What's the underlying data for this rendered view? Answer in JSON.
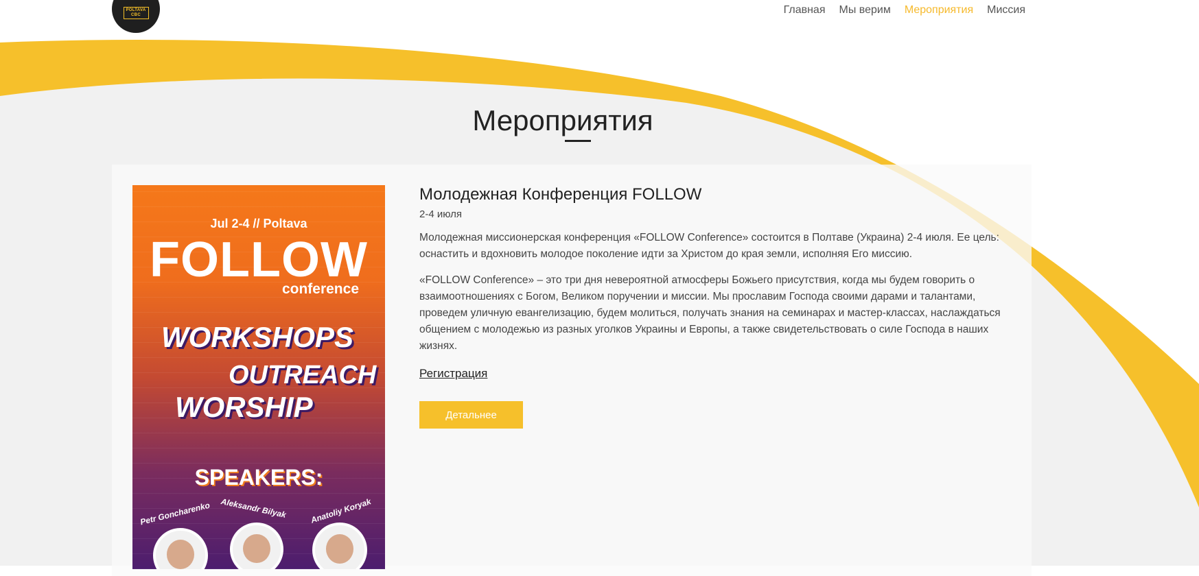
{
  "colors": {
    "accent": "#f6c02b",
    "active_nav": "#f6b92b",
    "dark": "#1f1f1f"
  },
  "logo": {
    "text_line1": "POLTAVA",
    "text_line2": "CBC"
  },
  "nav": {
    "items": [
      {
        "label": "Главная",
        "active": false
      },
      {
        "label": "Мы верим",
        "active": false
      },
      {
        "label": "Мероприятия",
        "active": true
      },
      {
        "label": "Миссия",
        "active": false
      }
    ]
  },
  "page": {
    "title": "Мероприятия"
  },
  "event": {
    "title": "Молодежная Конференция FOLLOW",
    "date": "2-4 июля",
    "paragraph1": "Молодежная миссионерская конференция «FOLLOW Conference» состоится в Полтаве (Украина) 2-4 июля. Ее цель: оснастить и вдохновить молодое поколение идти за Христом до края земли, исполняя Его миссию.",
    "paragraph2": "«FOLLOW Conference» – это три дня невероятной атмосферы Божьего присутствия, когда мы будем говорить о взаимоотношениях с Богом, Великом поручении и миссии. Мы прославим Господа своими дарами и талантами, проведем уличную евангелизацию, будем молиться, получать знания на семинарах и мастер-классах, наслаждаться общением с молодежью из разных уголков Украины и Европы, а также свидетельствовать о силе Господа в наших жизнях.",
    "register_link": "Регистрация",
    "details_button": "Детальнее"
  },
  "poster": {
    "date": "Jul 2-4 // Poltava",
    "brand": "FOLLOW",
    "brand_sub": "conference",
    "line1": "WORKSHOPS",
    "line2": "OUTREACH",
    "line3": "WORSHIP",
    "speakers_label": "SPEAKERS:",
    "speakers": [
      "Petr Goncharenko",
      "Aleksandr Bilyak",
      "Anatoliy Koryak"
    ]
  }
}
